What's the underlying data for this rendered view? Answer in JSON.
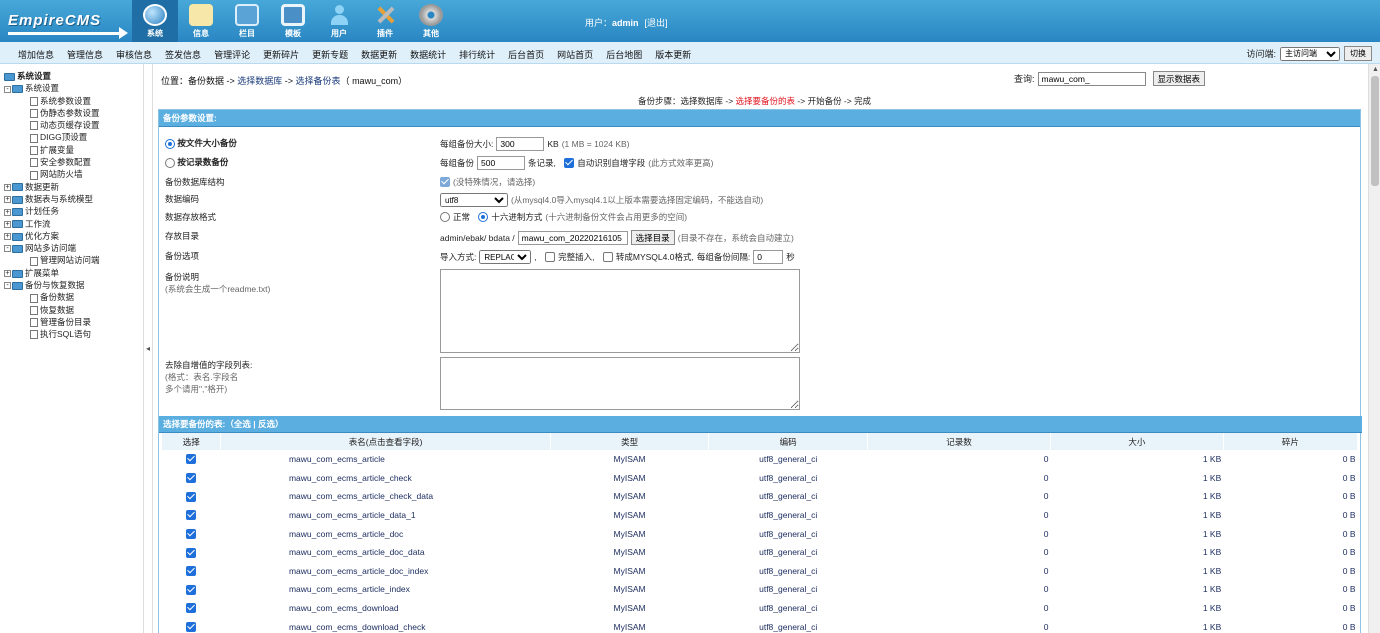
{
  "brand": {
    "logo": "EmpireCMS"
  },
  "topnav": [
    {
      "label": "系统",
      "icon": "globe-icon",
      "active": true
    },
    {
      "label": "信息",
      "icon": "note-icon"
    },
    {
      "label": "栏目",
      "icon": "folder-icon"
    },
    {
      "label": "模板",
      "icon": "template-icon"
    },
    {
      "label": "用户",
      "icon": "user-icon"
    },
    {
      "label": "插件",
      "icon": "plugin-icon"
    },
    {
      "label": "其他",
      "icon": "gear-icon"
    }
  ],
  "userinfo": {
    "prefix": "用户：",
    "username": "admin",
    "logout": "[退出]"
  },
  "menubar": [
    "增加信息",
    "管理信息",
    "审核信息",
    "签发信息",
    "管理评论",
    "更新碎片",
    "更新专题",
    "数据更新",
    "数据统计",
    "排行统计",
    "后台首页",
    "网站首页",
    "后台地图",
    "版本更新"
  ],
  "visit": {
    "label": "访问端:",
    "selected": "主访问端",
    "button": "切换"
  },
  "sidebar": {
    "root": "系统设置",
    "items": [
      {
        "label": "系统设置",
        "level": 1,
        "type": "folder",
        "toggle": "-"
      },
      {
        "label": "系统参数设置",
        "level": 3,
        "type": "doc"
      },
      {
        "label": "伪静态参数设置",
        "level": 3,
        "type": "doc"
      },
      {
        "label": "动态页缓存设置",
        "level": 3,
        "type": "doc"
      },
      {
        "label": "DIGG顶设置",
        "level": 3,
        "type": "doc"
      },
      {
        "label": "扩展变量",
        "level": 3,
        "type": "doc"
      },
      {
        "label": "安全参数配置",
        "level": 3,
        "type": "doc"
      },
      {
        "label": "网站防火墙",
        "level": 3,
        "type": "doc"
      },
      {
        "label": "数据更新",
        "level": 1,
        "type": "folder",
        "toggle": "+"
      },
      {
        "label": "数据表与系统模型",
        "level": 1,
        "type": "folder",
        "toggle": "+"
      },
      {
        "label": "计划任务",
        "level": 1,
        "type": "folder",
        "toggle": "+"
      },
      {
        "label": "工作流",
        "level": 1,
        "type": "folder",
        "toggle": "+"
      },
      {
        "label": "优化方案",
        "level": 1,
        "type": "folder",
        "toggle": "+"
      },
      {
        "label": "网站多访问端",
        "level": 1,
        "type": "folder",
        "toggle": "-"
      },
      {
        "label": "管理网站访问端",
        "level": 3,
        "type": "doc"
      },
      {
        "label": "扩展菜单",
        "level": 1,
        "type": "folder",
        "toggle": "+"
      },
      {
        "label": "备份与恢复数据",
        "level": 1,
        "type": "folder",
        "toggle": "-"
      },
      {
        "label": "备份数据",
        "level": 3,
        "type": "doc"
      },
      {
        "label": "恢复数据",
        "level": 3,
        "type": "doc"
      },
      {
        "label": "管理备份目录",
        "level": 3,
        "type": "doc"
      },
      {
        "label": "执行SQL语句",
        "level": 3,
        "type": "doc"
      }
    ]
  },
  "location": {
    "prefix": "位置：备份数据 -> ",
    "link1": "选择数据库",
    "sep": " -> ",
    "link2": "选择备份表",
    "suffix": "（ mawu_com）"
  },
  "search": {
    "label": "查询:",
    "value": "mawu_com_",
    "button": "显示数据表"
  },
  "steps": {
    "a": "备份步骤：选择数据库 -> ",
    "current": "选择要备份的表",
    "b": " -> 开始备份 -> 完成"
  },
  "params": {
    "title": "备份参数设置:",
    "by_size_label": "按文件大小备份",
    "by_size_prefix": "每组备份大小:",
    "by_size_value": "300",
    "by_size_unit": "KB",
    "by_size_note": "(1 MB = 1024 KB)",
    "by_rec_label": "按记录数备份",
    "by_rec_prefix": "每组备份",
    "by_rec_value": "500",
    "by_rec_unit": "条记录,",
    "autoinc_label": "自动识别自增字段",
    "autoinc_note": "(此方式效率更高)",
    "struct_label": "备份数据库结构",
    "struct_note": "(没特殊情况，请选择)",
    "charset_label": "数据编码",
    "charset_value": "utf8",
    "charset_note": "(从mysql4.0导入mysql4.1以上版本需要选择固定编码，不能选自动)",
    "format_label": "数据存放格式",
    "format_normal": "正常",
    "format_hex": "十六进制方式",
    "format_note": "(十六进制备份文件会占用更多的空间)",
    "dir_label": "存放目录",
    "dir_prefix": "admin/ebak/ bdata /",
    "dir_value": "mawu_com_20220216105",
    "dir_button": "选择目录",
    "dir_note": "(目录不存在，系统会自动建立)",
    "opt_label": "备份选项",
    "opt_import": "导入方式:",
    "opt_import_value": "REPLACE",
    "opt_comma": ",",
    "opt_full_insert": "完整插入,",
    "opt_mysql40": "转成MYSQL4.0格式,",
    "opt_interval": "每组备份间隔:",
    "opt_interval_value": "0",
    "opt_sec": "秒",
    "readme_label": "备份说明",
    "readme_note": "(系统会生成一个readme.txt)",
    "strip_label": "去除自增值的字段列表:",
    "strip_note1": "(格式：表名.字段名",
    "strip_note2": "多个请用\",\"格开)"
  },
  "tables": {
    "title": "选择要备份的表:",
    "select_all": "全选",
    "sep": "|",
    "invert": "反选",
    "columns": [
      "选择",
      "表名(点击查看字段)",
      "类型",
      "编码",
      "记录数",
      "大小",
      "碎片"
    ],
    "rows": [
      {
        "name": "mawu_com_ecms_article",
        "type": "MyISAM",
        "charset": "utf8_general_ci",
        "records": "0",
        "size": "1 KB",
        "frag": "0 B"
      },
      {
        "name": "mawu_com_ecms_article_check",
        "type": "MyISAM",
        "charset": "utf8_general_ci",
        "records": "0",
        "size": "1 KB",
        "frag": "0 B"
      },
      {
        "name": "mawu_com_ecms_article_check_data",
        "type": "MyISAM",
        "charset": "utf8_general_ci",
        "records": "0",
        "size": "1 KB",
        "frag": "0 B"
      },
      {
        "name": "mawu_com_ecms_article_data_1",
        "type": "MyISAM",
        "charset": "utf8_general_ci",
        "records": "0",
        "size": "1 KB",
        "frag": "0 B"
      },
      {
        "name": "mawu_com_ecms_article_doc",
        "type": "MyISAM",
        "charset": "utf8_general_ci",
        "records": "0",
        "size": "1 KB",
        "frag": "0 B"
      },
      {
        "name": "mawu_com_ecms_article_doc_data",
        "type": "MyISAM",
        "charset": "utf8_general_ci",
        "records": "0",
        "size": "1 KB",
        "frag": "0 B"
      },
      {
        "name": "mawu_com_ecms_article_doc_index",
        "type": "MyISAM",
        "charset": "utf8_general_ci",
        "records": "0",
        "size": "1 KB",
        "frag": "0 B"
      },
      {
        "name": "mawu_com_ecms_article_index",
        "type": "MyISAM",
        "charset": "utf8_general_ci",
        "records": "0",
        "size": "1 KB",
        "frag": "0 B"
      },
      {
        "name": "mawu_com_ecms_download",
        "type": "MyISAM",
        "charset": "utf8_general_ci",
        "records": "0",
        "size": "1 KB",
        "frag": "0 B"
      },
      {
        "name": "mawu_com_ecms_download_check",
        "type": "MyISAM",
        "charset": "utf8_general_ci",
        "records": "0",
        "size": "1 KB",
        "frag": "0 B"
      }
    ]
  }
}
